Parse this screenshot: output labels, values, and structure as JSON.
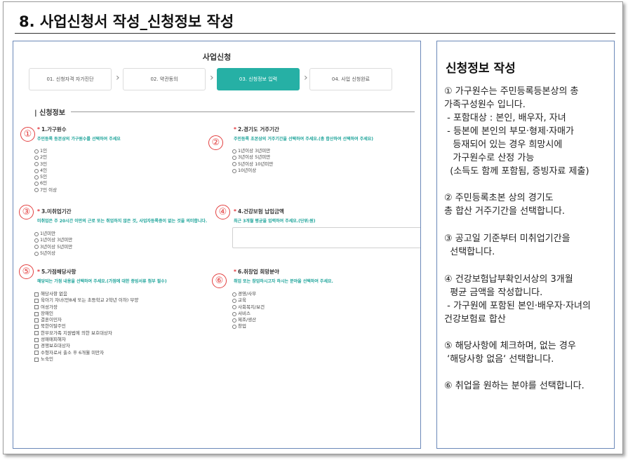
{
  "page": {
    "title": "8. 사업신청서 작성_신청정보 작성"
  },
  "form": {
    "heading": "사업신청",
    "steps": [
      {
        "label": "01. 신청자격 자가진단"
      },
      {
        "label": "02. 약관동의"
      },
      {
        "label": "03. 신청정보 입력"
      },
      {
        "label": "04. 사업 신청완료"
      }
    ],
    "active_step": 3,
    "section_title": "| 신청정보",
    "required_mark": "*",
    "fields": {
      "household": {
        "label": "1.가구원수",
        "desc": "주민등록 등본상의 가구원수를 선택하여 주세요",
        "options": [
          "1인",
          "2인",
          "3인",
          "4인",
          "5인",
          "6인",
          "7인 이상"
        ]
      },
      "residence": {
        "label": "2.경기도 거주기간",
        "desc": "주민등록 초본상의 거주기간을 선택하여 주세요.(총 합산하여 선택하여 주세요)",
        "options": [
          "1년이상 3년미만",
          "3년이상 5년미만",
          "5년이상 10년미만",
          "10년이상"
        ]
      },
      "unemployed": {
        "label": "3.미취업기간",
        "desc": "미취업은 주 20시간 이만의 근로 또는 취업하지 않은 것, 사업자등록증이 없는 것을 의미합니다.",
        "options": [
          "1년미만",
          "1년이상 3년미만",
          "3년이상 5년미만",
          "5년이상"
        ]
      },
      "insurance": {
        "label": "4.건강보험 납입금액",
        "desc": "최근 3개월 평균을 입력하여 주세요.(단위:원)",
        "value": ""
      },
      "eligibility": {
        "label": "5.가점해당사항",
        "desc": "해당되는 가점 내용을 선택하여 주세요.(가점에 대한 증빙서류 첨부 필수)",
        "options": [
          "해당사항 없음",
          "육아기 자녀(만8세 또는 초등학교 2학년 이하) 부양",
          "여성가장",
          "장애인",
          "결혼이민자",
          "북한이탈주민",
          "한부모가족 지원법에 의한 보호대상자",
          "성매매피해자",
          "경쟁보호대상자",
          "수형자로서 출소 후 6개월 미만자",
          "노숙인"
        ]
      },
      "field_of_work": {
        "label": "6.취창업 희망분야",
        "desc": "취업 또는 창업하시고자 하시는 분야을 선택하여 주세요.",
        "options": [
          "경영/사무",
          "교육",
          "사회복지/보건",
          "서비스",
          "제조/생산",
          "창업"
        ]
      }
    },
    "markers": [
      "①",
      "②",
      "③",
      "④",
      "⑤",
      "⑥"
    ]
  },
  "guide": {
    "title": "신청정보 작성",
    "blocks": [
      [
        "① 가구원수는 주민등록등본상의 총",
        "가족구성원수 입니다.",
        " - 포함대상 : 본인, 배우자, 자녀",
        " - 등본에 본인의 부모·형제·자매가",
        "   등재되어 있는 경우 희망시에",
        "   가구원수로 산정 가능",
        "  (소득도 함께 포함됨, 증빙자료 제출)"
      ],
      [
        "② 주민등록초본 상의 경기도",
        "총 합산 거주기간을 선택합니다."
      ],
      [
        "③ 공고일 기준부터 미취업기간을",
        "  선택합니다."
      ],
      [
        "④ 건강보험납부확인서상의 3개월",
        "  평균 금액을 작성합니다.",
        " - 가구원에 포함된 본인·배우자·자녀의",
        "건강보험료 합산"
      ],
      [
        "⑤ 해당사항에 체크하며, 없는 경우",
        " ‘해당사항 없음‘ 선택합니다."
      ],
      [
        "⑥ 취업을 원하는 분야를 선택합니다."
      ]
    ]
  }
}
